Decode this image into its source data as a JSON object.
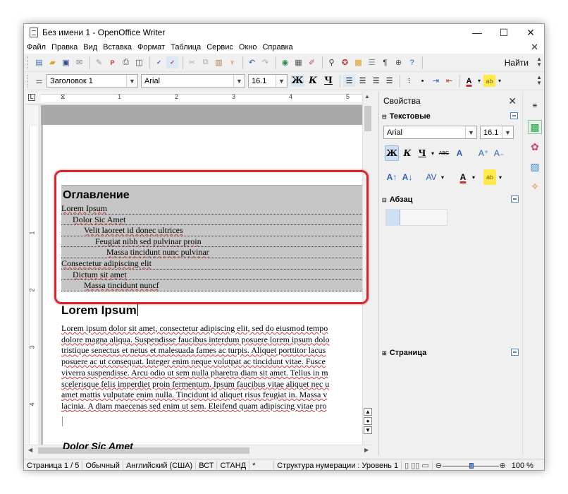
{
  "window": {
    "title": "Без имени 1 - OpenOffice Writer",
    "controls": {
      "minimize": "—",
      "maximize": "☐",
      "close": "✕"
    }
  },
  "menu": {
    "items": [
      "Файл",
      "Правка",
      "Вид",
      "Вставка",
      "Формат",
      "Таблица",
      "Сервис",
      "Окно",
      "Справка"
    ],
    "close_doc": "✕"
  },
  "toolbar": {
    "find_label": "Найти",
    "icons": [
      "new-icon",
      "open-icon",
      "save-icon",
      "email-icon",
      "edit-file-icon",
      "pdf-icon",
      "print-icon",
      "print-preview-icon",
      "spellcheck-icon",
      "autospellcheck-icon",
      "cut-icon",
      "copy-icon",
      "paste-icon",
      "clone-format-icon",
      "undo-icon",
      "redo-icon",
      "navigator-icon",
      "table-icon",
      "draw-functions-icon",
      "find-replace-icon",
      "navigator2-icon",
      "gallery-icon",
      "data-sources-icon",
      "nonprinting-chars-icon",
      "zoom-icon",
      "help-icon"
    ]
  },
  "format_bar": {
    "paragraph_style": "Заголовок 1",
    "font_name": "Arial",
    "font_size": "16.1",
    "bold": "Ж",
    "italic": "К",
    "underline": "Ч"
  },
  "ruler": {
    "h_numbers": [
      "1",
      "2",
      "3",
      "4",
      "5"
    ],
    "v_numbers": [
      "1",
      "2",
      "3",
      "4"
    ]
  },
  "document": {
    "toc_title": "Оглавление",
    "toc_entries": [
      {
        "text": "Lorem Ipsum",
        "level": 0
      },
      {
        "text": "Dolor Sic Amet",
        "level": 1
      },
      {
        "text": "Velit laoreet id donec ultrices",
        "level": 2
      },
      {
        "text": "Feugiat nibh sed pulvinar proin",
        "level": 3
      },
      {
        "text": "Massa tincidunt nunc pulvinar",
        "level": 4
      },
      {
        "text": "Consectetur adipiscing elit",
        "level": 0
      },
      {
        "text": "Dictum sit amet",
        "level": 1
      },
      {
        "text": "Massa tincidunt nuncf",
        "level": 2
      }
    ],
    "heading": "Lorem Ipsum",
    "body_lines": [
      "Lorem ipsum dolor sit amet, consectetur adipiscing elit, sed do eiusmod tempo",
      "dolore magna aliqua. Suspendisse faucibus interdum posuere lorem ipsum dolo",
      "tristique senectus et netus et malesuada fames ac turpis. Aliquet porttitor lacus",
      "posuere ac ut consequat. Integer enim neque volutpat ac tincidunt vitae. Fusce",
      "viverra suspendisse. Arcu odio ut sem nulla pharetra diam sit amet. Tellus in m",
      "scelerisque felis imperdiet proin fermentum. Ipsum faucibus vitae aliquet nec u",
      "amet mattis vulputate enim nulla. Tincidunt id aliquet risus feugiat in. Massa v",
      "lacinia. A diam maecenas sed enim ut sem. Eleifend quam adipiscing vitae pro"
    ],
    "subheading": "Dolor Sic Amet"
  },
  "sidebar": {
    "title": "Свойства",
    "text_panel": {
      "title": "Текстовые",
      "font_name": "Arial",
      "font_size": "16.1",
      "bold": "Ж",
      "italic": "К",
      "underline": "Ч",
      "strike": "ABC"
    },
    "paragraph_panel": {
      "title": "Абзац"
    },
    "page_panel": {
      "title": "Страница"
    }
  },
  "statusbar": {
    "page": "Страница  1 / 5",
    "style": "Обычный",
    "language": "Английский (США)",
    "insert_mode": "ВСТ",
    "selection_mode": "СТАНД",
    "modified": "*",
    "numbering": "Структура нумерации : Уровень  1",
    "zoom": "100 %"
  },
  "colors": {
    "highlight_border": "#e0232c",
    "toc_background": "#c6c6c6",
    "spell_underline": "#d83a3a"
  }
}
